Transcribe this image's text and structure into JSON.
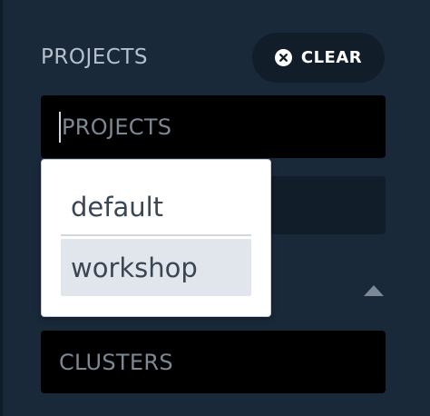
{
  "filters": {
    "projects": {
      "label": "PROJECTS",
      "placeholder": "PROJECTS",
      "value": ""
    },
    "clear_button": {
      "label": "CLEAR",
      "icon": "close-circle-icon"
    },
    "clusters": {
      "placeholder": "CLUSTERS",
      "value": ""
    },
    "collapse_icon": "chevron-up-icon"
  },
  "dropdown": {
    "options": [
      {
        "label": "default",
        "highlighted": false
      },
      {
        "label": "workshop",
        "highlighted": true
      }
    ]
  },
  "colors": {
    "panel_bg": "#19293a",
    "input_bg": "#000000",
    "button_bg": "#121d2a",
    "label_text": "#b6c0cc",
    "placeholder_text": "#7d8894",
    "option_text": "#3b4654",
    "option_highlight": "#e1e6ed"
  }
}
